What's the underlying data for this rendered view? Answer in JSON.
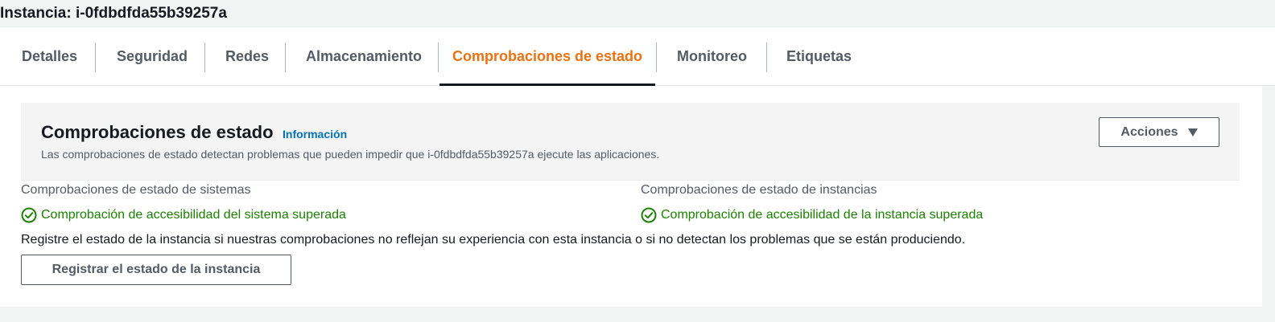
{
  "instance": {
    "title": "Instancia: i-0fdbdfda55b39257a"
  },
  "tabs": [
    {
      "label": "Detalles",
      "active": false
    },
    {
      "label": "Seguridad",
      "active": false
    },
    {
      "label": "Redes",
      "active": false
    },
    {
      "label": "Almacenamiento",
      "active": false
    },
    {
      "label": "Comprobaciones de estado",
      "active": true
    },
    {
      "label": "Monitoreo",
      "active": false
    },
    {
      "label": "Etiquetas",
      "active": false
    }
  ],
  "panel": {
    "title": "Comprobaciones de estado",
    "info_link": "Información",
    "description": "Las comprobaciones de estado detectan problemas que pueden impedir que i-0fdbdfda55b39257a ejecute las aplicaciones.",
    "actions_label": "Acciones"
  },
  "system_checks": {
    "label": "Comprobaciones de estado de sistemas",
    "status": "Comprobación de accesibilidad del sistema superada"
  },
  "instance_checks": {
    "label": "Comprobaciones de estado de instancias",
    "status": "Comprobación de accesibilidad de la instancia superada"
  },
  "report": {
    "note": "Registre el estado de la instancia si nuestras comprobaciones no reflejan su experiencia con esta instancia o si no detectan los problemas que se están produciendo.",
    "button_label": "Registrar el estado de la instancia"
  },
  "colors": {
    "active_tab": "#ec7211",
    "success": "#1d8102",
    "link": "#0073bb"
  },
  "icons": {
    "success": "check-circle-icon",
    "dropdown": "caret-down-icon"
  }
}
